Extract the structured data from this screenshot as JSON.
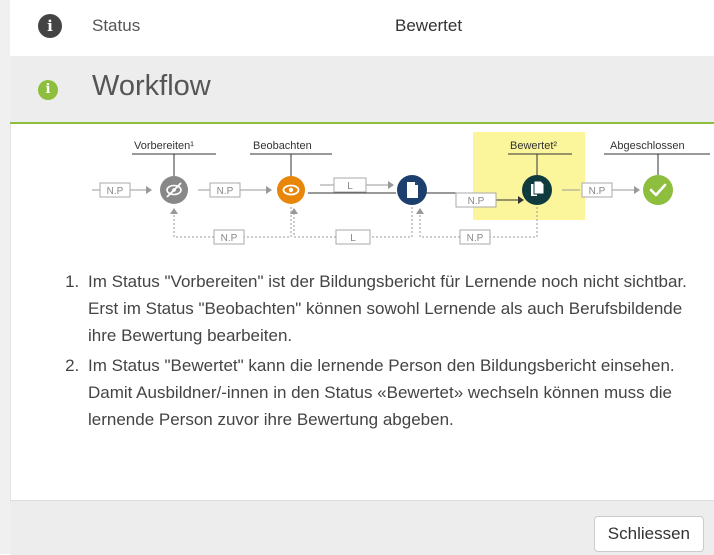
{
  "status": {
    "label": "Status",
    "value": "Bewertet",
    "icon": "info-icon"
  },
  "workflow": {
    "title": "Workflow",
    "icon": "info-icon",
    "accent": "#8dbe3d",
    "states": [
      {
        "label": "Vorbereiten¹",
        "icon": "eye-slash-icon",
        "color": "#888888"
      },
      {
        "label": "Beobachten",
        "icon": "eye-icon",
        "color": "#e8860a"
      },
      {
        "label": "",
        "icon": "document-icon",
        "color": "#1d3f6e"
      },
      {
        "label": "Bewertet²",
        "icon": "documents-icon",
        "color": "#0f3b3f",
        "highlight": "#fbf59b"
      },
      {
        "label": "Abgeschlossen",
        "icon": "check-icon",
        "color": "#8dbe3d"
      }
    ],
    "arrow_labels": {
      "np": "N.P",
      "np_short": "N.P",
      "l": "L"
    }
  },
  "notes": [
    "Im Status \"Vorbereiten\" ist der Bildungsbericht für Lernende noch nicht sichtbar. Erst im Status \"Beobachten\" können sowohl Lernende als auch Berufsbildende ihre Bewertung bearbeiten.",
    "Im Status \"Bewertet\" kann die lernende Person den Bildungsbericht einsehen. Damit Ausbildner/-innen in den Status «Bewertet» wechseln können muss die lernende Person zuvor ihre Bewertung abgeben."
  ],
  "footer": {
    "close_label": "Schliessen"
  }
}
